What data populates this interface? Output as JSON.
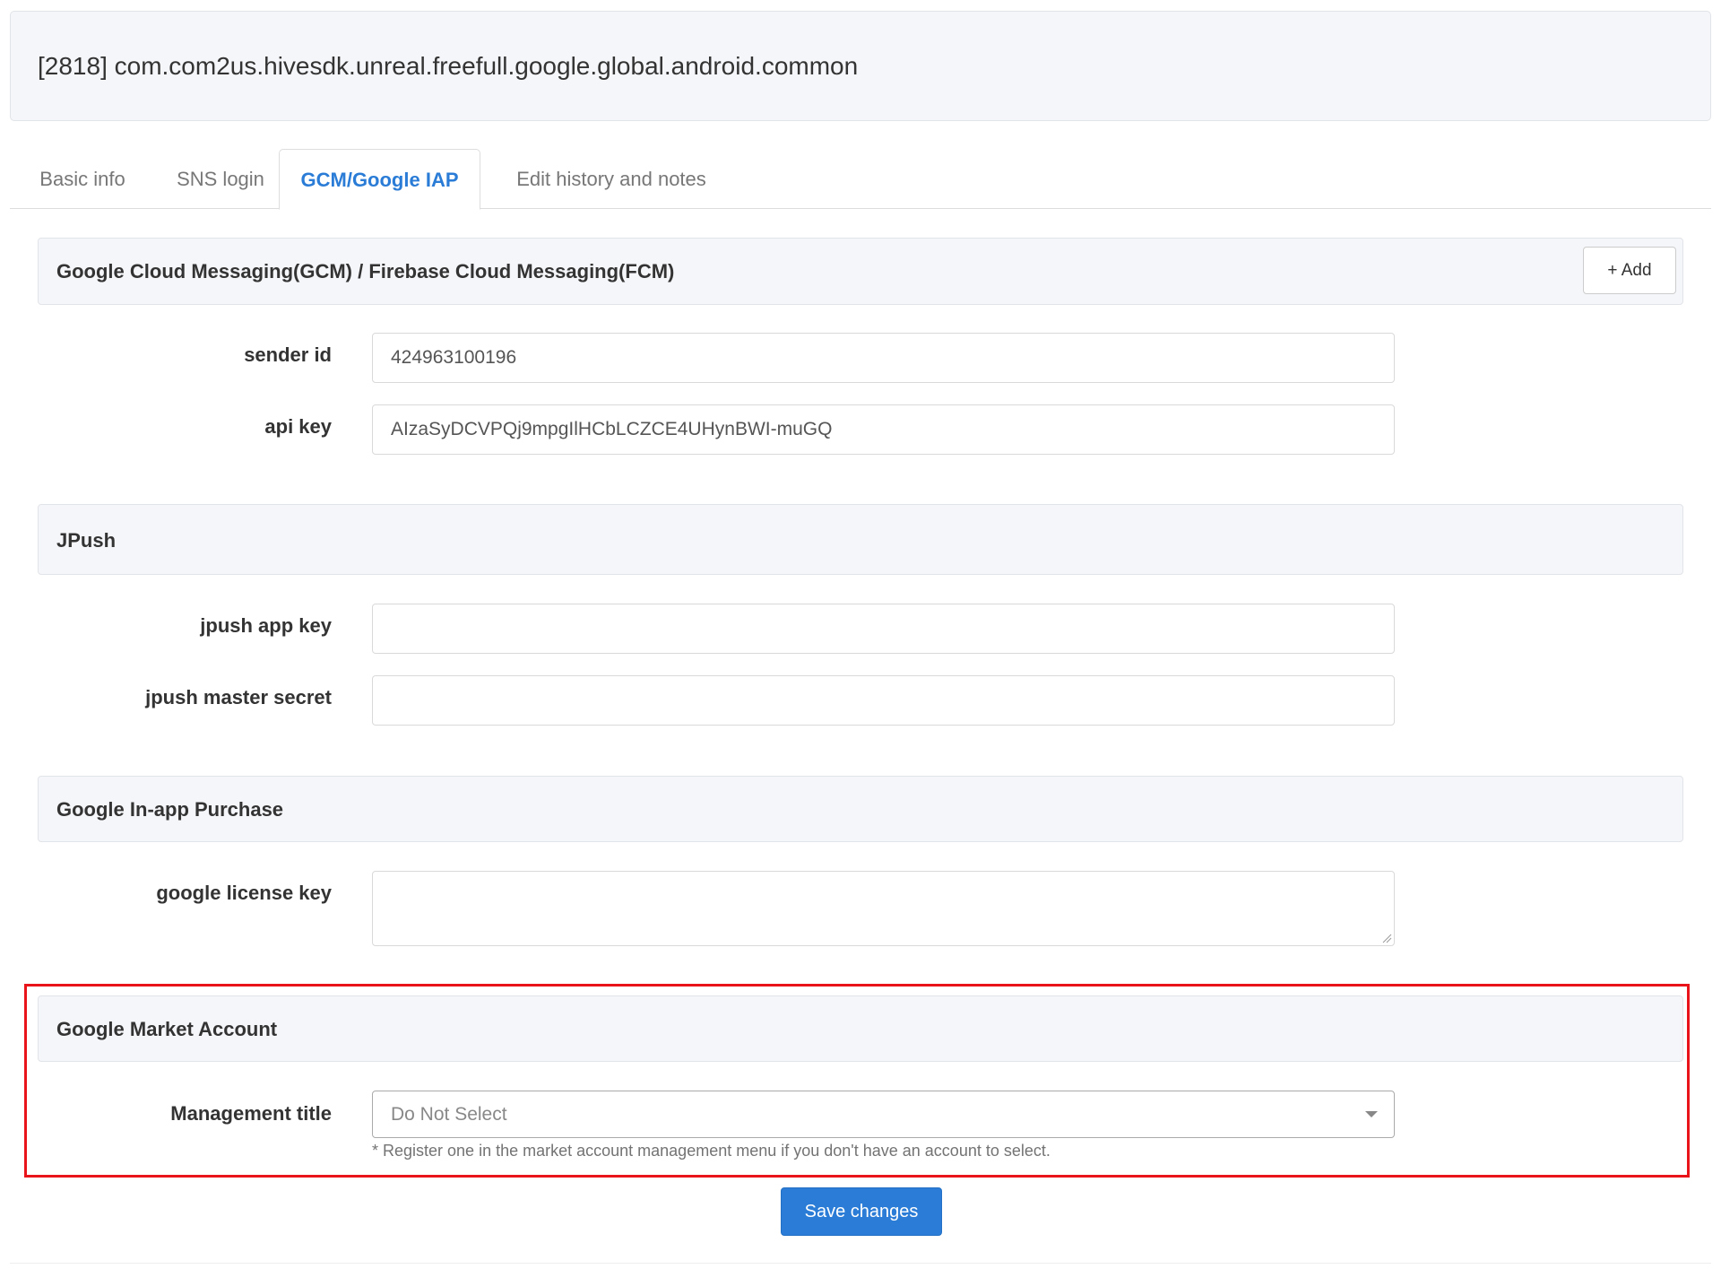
{
  "header": {
    "title": "[2818] com.com2us.hivesdk.unreal.freefull.google.global.android.common"
  },
  "tabs": [
    {
      "label": "Basic info",
      "active": false
    },
    {
      "label": "SNS login",
      "active": false
    },
    {
      "label": "GCM/Google IAP",
      "active": true
    },
    {
      "label": "Edit history and notes",
      "active": false
    }
  ],
  "gcm": {
    "title": "Google Cloud Messaging(GCM) / Firebase Cloud Messaging(FCM)",
    "add_label": "+ Add",
    "sender_id_label": "sender id",
    "sender_id_value": "424963100196",
    "api_key_label": "api key",
    "api_key_value": "AIzaSyDCVPQj9mpgIlHCbLCZCE4UHynBWI-muGQ"
  },
  "jpush": {
    "title": "JPush",
    "app_key_label": "jpush app key",
    "app_key_value": "",
    "master_secret_label": "jpush master secret",
    "master_secret_value": ""
  },
  "iap": {
    "title": "Google In-app Purchase",
    "license_key_label": "google license key",
    "license_key_value": ""
  },
  "market": {
    "title": "Google Market Account",
    "management_title_label": "Management title",
    "selected_option": "Do Not Select",
    "help_text": "* Register one in the market account management menu if you don't have an account to select."
  },
  "actions": {
    "save_label": "Save changes"
  },
  "colors": {
    "accent": "#2a7cd6",
    "highlight": "#e8141a",
    "panel_bg": "#f5f6f9"
  }
}
